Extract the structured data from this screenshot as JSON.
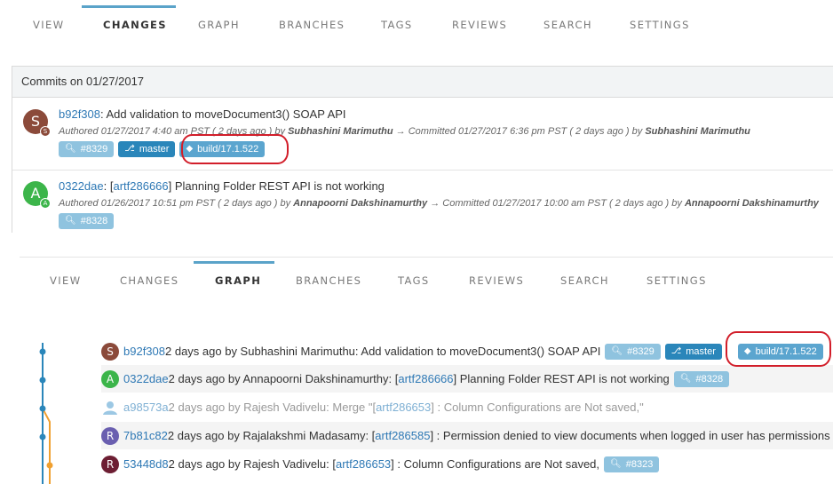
{
  "panel1": {
    "tabs": [
      "VIEW",
      "CHANGES",
      "GRAPH",
      "BRANCHES",
      "TAGS",
      "REVIEWS",
      "SEARCH",
      "SETTINGS"
    ],
    "active_tab": "CHANGES",
    "commits_header": "Commits on 01/27/2017",
    "commits": [
      {
        "avatar_letter": "S",
        "avatar_mini": "S",
        "avatar_color": "#8b4a3a",
        "hash": "b92f308",
        "message": ": Add validation to moveDocument3() SOAP API",
        "authored": "Authored  01/27/2017 4:40 am PST ( 2 days ago ) by ",
        "author": "Subhashini Marimuthu",
        "committed": " → Committed 01/27/2017 6:36 pm PST ( 2 days ago ) by ",
        "committer": "Subhashini Marimuthu",
        "badges": [
          {
            "kind": "review",
            "icon": "search-icon",
            "label": "#8329"
          },
          {
            "kind": "branch",
            "icon": "branch-icon",
            "label": "master"
          },
          {
            "kind": "build",
            "icon": "tag-icon",
            "label": "build/17.1.522"
          }
        ]
      },
      {
        "avatar_letter": "A",
        "avatar_mini": "A",
        "avatar_color": "#3cb54a",
        "hash": "0322dae",
        "message_pre": ": [",
        "ticket": "artf286666",
        "message": "] Planning Folder REST API is not working",
        "authored": "Authored  01/26/2017 10:51 pm PST ( 2 days ago ) by ",
        "author": "Annapoorni Dakshinamurthy",
        "committed": " → Committed 01/27/2017 10:00 am PST ( 2 days ago ) by ",
        "committer": "Annapoorni Dakshinamurthy",
        "badges": [
          {
            "kind": "review",
            "icon": "search-icon",
            "label": "#8328"
          }
        ]
      }
    ]
  },
  "panel2": {
    "tabs": [
      "VIEW",
      "CHANGES",
      "GRAPH",
      "BRANCHES",
      "TAGS",
      "REVIEWS",
      "SEARCH",
      "SETTINGS"
    ],
    "active_tab": "GRAPH",
    "rows": [
      {
        "avatar": "S",
        "color": "#8b4a3a",
        "hash": "b92f308",
        "text": " 2 days ago by Subhashini Marimuthu: Add validation to moveDocument3() SOAP API",
        "review": "#8329",
        "branch": "master",
        "build": "build/17.1.522"
      },
      {
        "avatar": "A",
        "color": "#3cb54a",
        "hash": "0322dae",
        "text": " 2 days ago by Annapoorni Dakshinamurthy: [",
        "ticket": "artf286666",
        "text2": "] Planning Folder REST API is not working",
        "review": "#8328"
      },
      {
        "avatar": "",
        "color": "#9cc8e4",
        "hash": "a98573a",
        "text": " 2 days ago by Rajesh Vadivelu: Merge \"[",
        "ticket": "artf286653",
        "text2": "] : Column Configurations are Not saved,\""
      },
      {
        "avatar": "R",
        "color": "#6a5fb0",
        "hash": "7b81c82",
        "text": " 2 days ago by Rajalakshmi Madasamy: [",
        "ticket": "artf286585",
        "text2": "] : Permission denied to view documents when logged in user has permissions"
      },
      {
        "avatar": "R",
        "color": "#6d1e33",
        "hash": "53448d8",
        "text": " 2 days ago by Rajesh Vadivelu: [",
        "ticket": "artf286653",
        "text2": "] : Column Configurations are Not saved,",
        "review": "#8323"
      }
    ]
  },
  "colors": {
    "accent": "#5aa3c9",
    "highlight": "#d21e2a",
    "branch_line": "#2a86ba",
    "merge_line": "#f0a030"
  }
}
